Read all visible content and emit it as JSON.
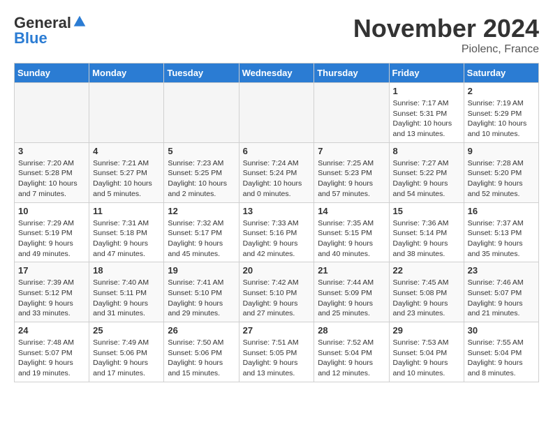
{
  "header": {
    "logo_general": "General",
    "logo_blue": "Blue",
    "month_title": "November 2024",
    "location": "Piolenc, France"
  },
  "weekdays": [
    "Sunday",
    "Monday",
    "Tuesday",
    "Wednesday",
    "Thursday",
    "Friday",
    "Saturday"
  ],
  "weeks": [
    [
      {
        "day": "",
        "sunrise": "",
        "sunset": "",
        "daylight": ""
      },
      {
        "day": "",
        "sunrise": "",
        "sunset": "",
        "daylight": ""
      },
      {
        "day": "",
        "sunrise": "",
        "sunset": "",
        "daylight": ""
      },
      {
        "day": "",
        "sunrise": "",
        "sunset": "",
        "daylight": ""
      },
      {
        "day": "",
        "sunrise": "",
        "sunset": "",
        "daylight": ""
      },
      {
        "day": "1",
        "sunrise": "Sunrise: 7:17 AM",
        "sunset": "Sunset: 5:31 PM",
        "daylight": "Daylight: 10 hours and 13 minutes."
      },
      {
        "day": "2",
        "sunrise": "Sunrise: 7:19 AM",
        "sunset": "Sunset: 5:29 PM",
        "daylight": "Daylight: 10 hours and 10 minutes."
      }
    ],
    [
      {
        "day": "3",
        "sunrise": "Sunrise: 7:20 AM",
        "sunset": "Sunset: 5:28 PM",
        "daylight": "Daylight: 10 hours and 7 minutes."
      },
      {
        "day": "4",
        "sunrise": "Sunrise: 7:21 AM",
        "sunset": "Sunset: 5:27 PM",
        "daylight": "Daylight: 10 hours and 5 minutes."
      },
      {
        "day": "5",
        "sunrise": "Sunrise: 7:23 AM",
        "sunset": "Sunset: 5:25 PM",
        "daylight": "Daylight: 10 hours and 2 minutes."
      },
      {
        "day": "6",
        "sunrise": "Sunrise: 7:24 AM",
        "sunset": "Sunset: 5:24 PM",
        "daylight": "Daylight: 10 hours and 0 minutes."
      },
      {
        "day": "7",
        "sunrise": "Sunrise: 7:25 AM",
        "sunset": "Sunset: 5:23 PM",
        "daylight": "Daylight: 9 hours and 57 minutes."
      },
      {
        "day": "8",
        "sunrise": "Sunrise: 7:27 AM",
        "sunset": "Sunset: 5:22 PM",
        "daylight": "Daylight: 9 hours and 54 minutes."
      },
      {
        "day": "9",
        "sunrise": "Sunrise: 7:28 AM",
        "sunset": "Sunset: 5:20 PM",
        "daylight": "Daylight: 9 hours and 52 minutes."
      }
    ],
    [
      {
        "day": "10",
        "sunrise": "Sunrise: 7:29 AM",
        "sunset": "Sunset: 5:19 PM",
        "daylight": "Daylight: 9 hours and 49 minutes."
      },
      {
        "day": "11",
        "sunrise": "Sunrise: 7:31 AM",
        "sunset": "Sunset: 5:18 PM",
        "daylight": "Daylight: 9 hours and 47 minutes."
      },
      {
        "day": "12",
        "sunrise": "Sunrise: 7:32 AM",
        "sunset": "Sunset: 5:17 PM",
        "daylight": "Daylight: 9 hours and 45 minutes."
      },
      {
        "day": "13",
        "sunrise": "Sunrise: 7:33 AM",
        "sunset": "Sunset: 5:16 PM",
        "daylight": "Daylight: 9 hours and 42 minutes."
      },
      {
        "day": "14",
        "sunrise": "Sunrise: 7:35 AM",
        "sunset": "Sunset: 5:15 PM",
        "daylight": "Daylight: 9 hours and 40 minutes."
      },
      {
        "day": "15",
        "sunrise": "Sunrise: 7:36 AM",
        "sunset": "Sunset: 5:14 PM",
        "daylight": "Daylight: 9 hours and 38 minutes."
      },
      {
        "day": "16",
        "sunrise": "Sunrise: 7:37 AM",
        "sunset": "Sunset: 5:13 PM",
        "daylight": "Daylight: 9 hours and 35 minutes."
      }
    ],
    [
      {
        "day": "17",
        "sunrise": "Sunrise: 7:39 AM",
        "sunset": "Sunset: 5:12 PM",
        "daylight": "Daylight: 9 hours and 33 minutes."
      },
      {
        "day": "18",
        "sunrise": "Sunrise: 7:40 AM",
        "sunset": "Sunset: 5:11 PM",
        "daylight": "Daylight: 9 hours and 31 minutes."
      },
      {
        "day": "19",
        "sunrise": "Sunrise: 7:41 AM",
        "sunset": "Sunset: 5:10 PM",
        "daylight": "Daylight: 9 hours and 29 minutes."
      },
      {
        "day": "20",
        "sunrise": "Sunrise: 7:42 AM",
        "sunset": "Sunset: 5:10 PM",
        "daylight": "Daylight: 9 hours and 27 minutes."
      },
      {
        "day": "21",
        "sunrise": "Sunrise: 7:44 AM",
        "sunset": "Sunset: 5:09 PM",
        "daylight": "Daylight: 9 hours and 25 minutes."
      },
      {
        "day": "22",
        "sunrise": "Sunrise: 7:45 AM",
        "sunset": "Sunset: 5:08 PM",
        "daylight": "Daylight: 9 hours and 23 minutes."
      },
      {
        "day": "23",
        "sunrise": "Sunrise: 7:46 AM",
        "sunset": "Sunset: 5:07 PM",
        "daylight": "Daylight: 9 hours and 21 minutes."
      }
    ],
    [
      {
        "day": "24",
        "sunrise": "Sunrise: 7:48 AM",
        "sunset": "Sunset: 5:07 PM",
        "daylight": "Daylight: 9 hours and 19 minutes."
      },
      {
        "day": "25",
        "sunrise": "Sunrise: 7:49 AM",
        "sunset": "Sunset: 5:06 PM",
        "daylight": "Daylight: 9 hours and 17 minutes."
      },
      {
        "day": "26",
        "sunrise": "Sunrise: 7:50 AM",
        "sunset": "Sunset: 5:06 PM",
        "daylight": "Daylight: 9 hours and 15 minutes."
      },
      {
        "day": "27",
        "sunrise": "Sunrise: 7:51 AM",
        "sunset": "Sunset: 5:05 PM",
        "daylight": "Daylight: 9 hours and 13 minutes."
      },
      {
        "day": "28",
        "sunrise": "Sunrise: 7:52 AM",
        "sunset": "Sunset: 5:04 PM",
        "daylight": "Daylight: 9 hours and 12 minutes."
      },
      {
        "day": "29",
        "sunrise": "Sunrise: 7:53 AM",
        "sunset": "Sunset: 5:04 PM",
        "daylight": "Daylight: 9 hours and 10 minutes."
      },
      {
        "day": "30",
        "sunrise": "Sunrise: 7:55 AM",
        "sunset": "Sunset: 5:04 PM",
        "daylight": "Daylight: 9 hours and 8 minutes."
      }
    ]
  ]
}
